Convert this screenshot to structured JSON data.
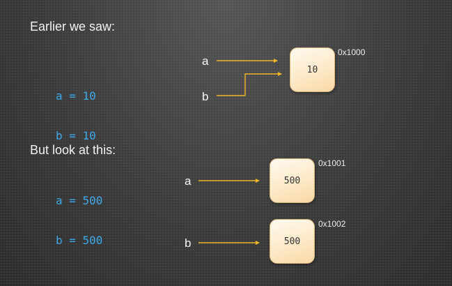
{
  "section1": {
    "heading": "Earlier we saw:",
    "code_lines": [
      "a = 10",
      "b = 10"
    ],
    "labels": {
      "a": "a",
      "b": "b"
    },
    "object": {
      "value": "10",
      "address": "0x1000"
    }
  },
  "section2": {
    "heading": "But look at this:",
    "code_lines": [
      "a = 500",
      "b = 500"
    ],
    "labels": {
      "a": "a",
      "b": "b"
    },
    "objects": [
      {
        "value": "500",
        "address": "0x1001"
      },
      {
        "value": "500",
        "address": "0x1002"
      }
    ]
  },
  "colors": {
    "code": "#3fa9e8",
    "arrow": "#f0b429",
    "box_fill": "#fde9c8"
  }
}
